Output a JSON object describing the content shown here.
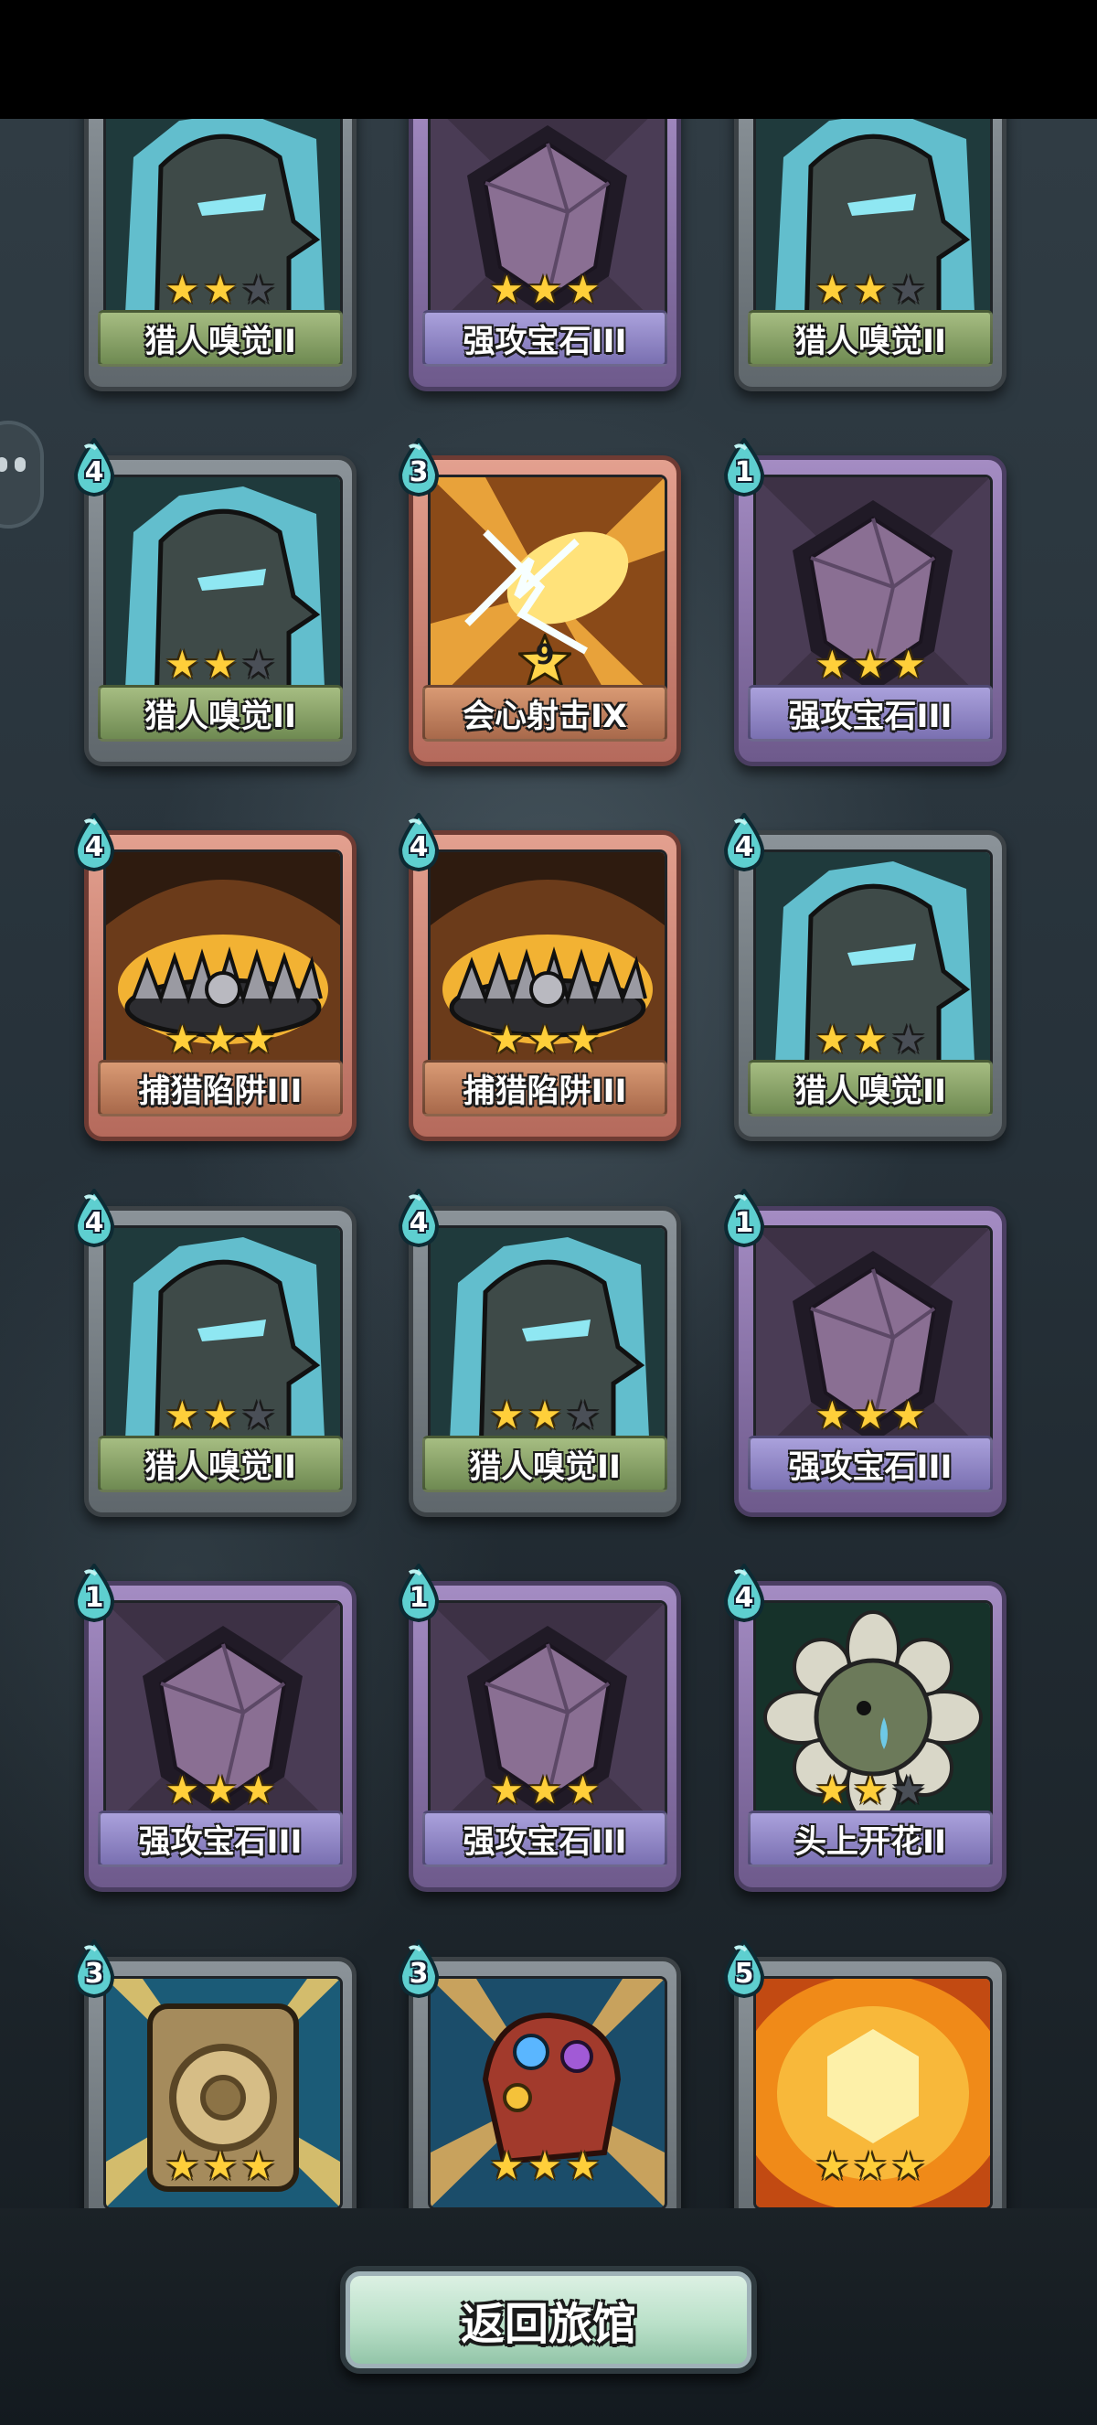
{
  "screen": {
    "return_button_label": "返回旅馆"
  },
  "colors": {
    "star_on": "#ffcf3a",
    "star_off": "#4a4f57",
    "cost_drop": "#5ecfd0",
    "rarity_green": "#7f9a5e",
    "rarity_purple": "#8c80c2",
    "rarity_red": "#b8765a"
  },
  "cards": [
    {
      "name": "猎人嗅觉II",
      "cost": "",
      "stars": 2,
      "rarity": "green",
      "art": "hunter-icon"
    },
    {
      "name": "强攻宝石III",
      "cost": "",
      "stars": 3,
      "rarity": "purple",
      "art": "gem-icon"
    },
    {
      "name": "猎人嗅觉II",
      "cost": "",
      "stars": 2,
      "rarity": "green",
      "art": "hunter-icon"
    },
    {
      "name": "猎人嗅觉II",
      "cost": "4",
      "stars": 2,
      "rarity": "green",
      "art": "hunter-icon"
    },
    {
      "name": "会心射击IX",
      "cost": "3",
      "stars": 0,
      "level": "9",
      "rarity": "red",
      "art": "lightning-icon"
    },
    {
      "name": "强攻宝石III",
      "cost": "1",
      "stars": 3,
      "rarity": "purple",
      "art": "gem-icon"
    },
    {
      "name": "捕猎陷阱III",
      "cost": "4",
      "stars": 3,
      "rarity": "red",
      "art": "trap-icon"
    },
    {
      "name": "捕猎陷阱III",
      "cost": "4",
      "stars": 3,
      "rarity": "red",
      "art": "trap-icon"
    },
    {
      "name": "猎人嗅觉II",
      "cost": "4",
      "stars": 2,
      "rarity": "green",
      "art": "hunter-icon"
    },
    {
      "name": "猎人嗅觉II",
      "cost": "4",
      "stars": 2,
      "rarity": "green",
      "art": "hunter-icon"
    },
    {
      "name": "猎人嗅觉II",
      "cost": "4",
      "stars": 2,
      "rarity": "green",
      "art": "hunter-icon"
    },
    {
      "name": "强攻宝石III",
      "cost": "1",
      "stars": 3,
      "rarity": "purple",
      "art": "gem-icon"
    },
    {
      "name": "强攻宝石III",
      "cost": "1",
      "stars": 3,
      "rarity": "purple",
      "art": "gem-icon"
    },
    {
      "name": "强攻宝石III",
      "cost": "1",
      "stars": 3,
      "rarity": "purple",
      "art": "gem-icon"
    },
    {
      "name": "头上开花II",
      "cost": "4",
      "stars": 2,
      "rarity": "purple",
      "art": "flower-icon"
    },
    {
      "name": "",
      "cost": "3",
      "stars": 3,
      "rarity": "green",
      "art": "tablet-icon"
    },
    {
      "name": "",
      "cost": "3",
      "stars": 3,
      "rarity": "green",
      "art": "gauntlet-icon"
    },
    {
      "name": "",
      "cost": "5",
      "stars": 3,
      "rarity": "green",
      "art": "fire-icon"
    }
  ]
}
